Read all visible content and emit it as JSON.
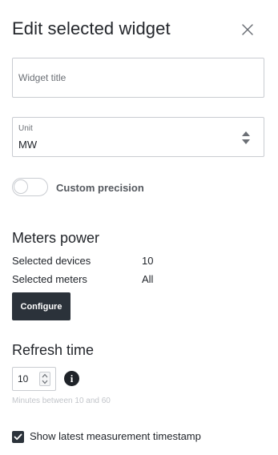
{
  "dialog": {
    "title": "Edit selected widget"
  },
  "widget_title": {
    "value": "",
    "placeholder": "Widget title"
  },
  "unit": {
    "label": "Unit",
    "value": "MW"
  },
  "custom_precision": {
    "label": "Custom precision",
    "enabled": false
  },
  "meters_power": {
    "heading": "Meters power",
    "rows": [
      {
        "key": "Selected devices",
        "value": "10"
      },
      {
        "key": "Selected meters",
        "value": "All"
      }
    ],
    "configure_label": "Configure"
  },
  "refresh": {
    "heading": "Refresh time",
    "value": "10",
    "info_glyph": "i",
    "hint": "Minutes between 10 and 60"
  },
  "timestamp": {
    "label": "Show latest measurement timestamp",
    "checked": true
  },
  "colors": {
    "dark_button": "#2b323a",
    "border": "#c9ccd1",
    "hint_text": "#c2c5ca"
  },
  "icons": {
    "close": "close-icon",
    "select_arrows": "chevron-up-down-icon",
    "info": "info-icon",
    "check": "checkmark-icon"
  }
}
